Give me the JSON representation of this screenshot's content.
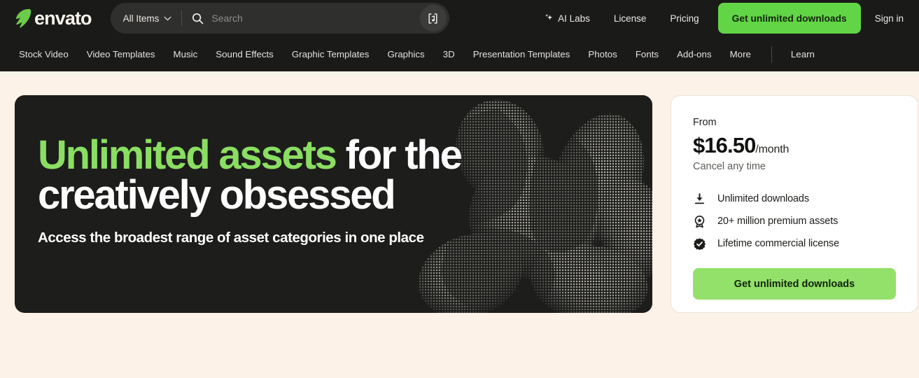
{
  "brand": {
    "name": "envato",
    "logo_icon": "envato-bolt-logo",
    "logo_color": "#6ccb4a",
    "wordmark_color": "#f7f3ec"
  },
  "colors": {
    "page_background": "#fdf2e7",
    "nav_background": "#1a1a19",
    "hero_background": "#1d1d1c",
    "accent_green_header": "#62d546",
    "accent_green_card": "#93e06a",
    "headline_green": "#8ade62",
    "card_background": "#ffffff"
  },
  "search": {
    "scope_label": "All Items",
    "scope_chevron_icon": "chevron-down-icon",
    "search_icon": "search-icon",
    "placeholder": "Search",
    "value": "",
    "audio_search_icon": "music-note-bracket-icon"
  },
  "top_nav": {
    "ai_labs": {
      "label": "AI Labs",
      "icon": "sparkle-icon"
    },
    "links": [
      "License",
      "Pricing"
    ],
    "cta_label": "Get unlimited downloads",
    "signin_label": "Sign in"
  },
  "category_nav": {
    "items": [
      "Stock Video",
      "Video Templates",
      "Music",
      "Sound Effects",
      "Graphic Templates",
      "Graphics",
      "3D",
      "Presentation Templates",
      "Photos",
      "Fonts",
      "Add-ons",
      "More"
    ],
    "trailing_item": "Learn"
  },
  "hero": {
    "headline_green": "Unlimited assets",
    "headline_white_1": " for the",
    "headline_white_2": "creatively obsessed",
    "subheadline": "Access the broadest range of asset categories in one place",
    "background_image": "halftone-portrait-photo"
  },
  "pricing_card": {
    "from_label": "From",
    "price": "$16.50",
    "period": "/month",
    "cancel_note": "Cancel any time",
    "features": [
      {
        "icon": "download-icon",
        "label": "Unlimited downloads"
      },
      {
        "icon": "award-badge-star-icon",
        "label": "20+ million premium assets"
      },
      {
        "icon": "verified-check-badge-icon",
        "label": "Lifetime commercial license"
      }
    ],
    "cta_label": "Get unlimited downloads"
  }
}
